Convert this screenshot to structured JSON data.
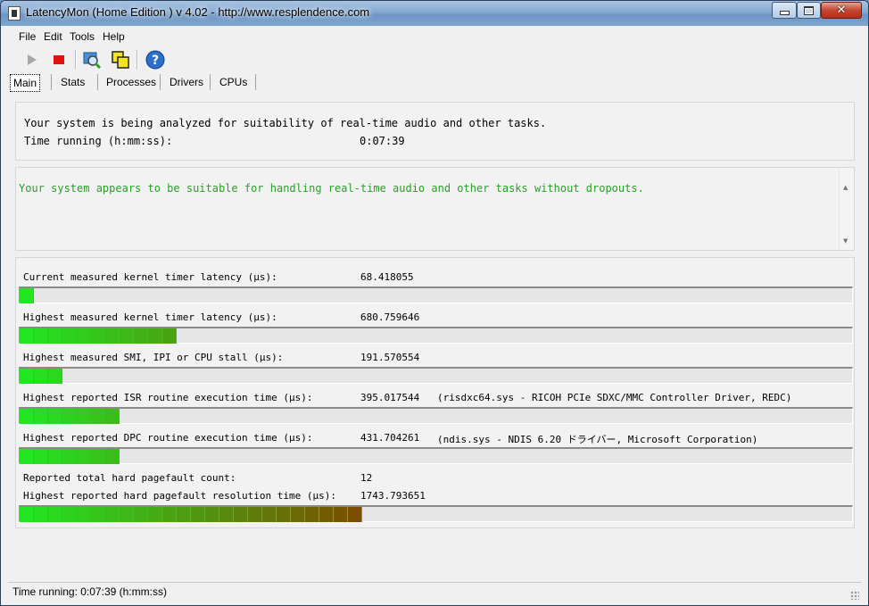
{
  "window": {
    "title": "LatencyMon  (Home Edition )  v 4.02 - http://www.resplendence.com"
  },
  "menu": [
    "File",
    "Edit",
    "Tools",
    "Help"
  ],
  "toolbar": {
    "icons": [
      "play-icon",
      "stop-icon",
      "search-icon",
      "copy-icon",
      "help-icon"
    ]
  },
  "tabs": [
    "Main",
    "Stats",
    "Processes",
    "Drivers",
    "CPUs"
  ],
  "active_tab": "Main",
  "analysis": {
    "line1": "Your system is being analyzed for suitability of real-time audio and other tasks.",
    "time_label": "Time running (h:mm:ss):",
    "time_value": "0:07:39"
  },
  "verdict": {
    "text": "Your system appears to be suitable for handling real-time audio and other tasks without dropouts.",
    "color": "#2a9e2a"
  },
  "metrics": [
    {
      "label": "Current measured kernel timer latency (µs):",
      "value": "68.418055",
      "detail": "",
      "segments": 1
    },
    {
      "label": "Highest measured kernel timer latency (µs):",
      "value": "680.759646",
      "detail": "",
      "segments": 11
    },
    {
      "label": "Highest measured SMI, IPI or CPU stall (µs):",
      "value": "191.570554",
      "detail": "",
      "segments": 3
    },
    {
      "label": "Highest reported ISR routine execution time (µs):",
      "value": "395.017544",
      "detail": "(risdxc64.sys - RICOH PCIe SDXC/MMC Controller Driver, REDC)",
      "segments": 7
    },
    {
      "label": "Highest reported DPC routine execution time (µs):",
      "value": "431.704261",
      "detail": "(ndis.sys - NDIS 6.20 ドライバー, Microsoft Corporation)",
      "segments": 7
    }
  ],
  "pagefault": {
    "count_label": "Reported total hard pagefault count:",
    "count_value": "12",
    "time_label": "Highest reported hard pagefault resolution time (µs):",
    "time_value": "1743.793651",
    "segments": 24
  },
  "status": {
    "text": "Time running: 0:07:39  (h:mm:ss)"
  },
  "colors": {
    "bar_start": "#22e622",
    "bar_end": "#7a4e00",
    "verdict": "#2a9e2a"
  }
}
